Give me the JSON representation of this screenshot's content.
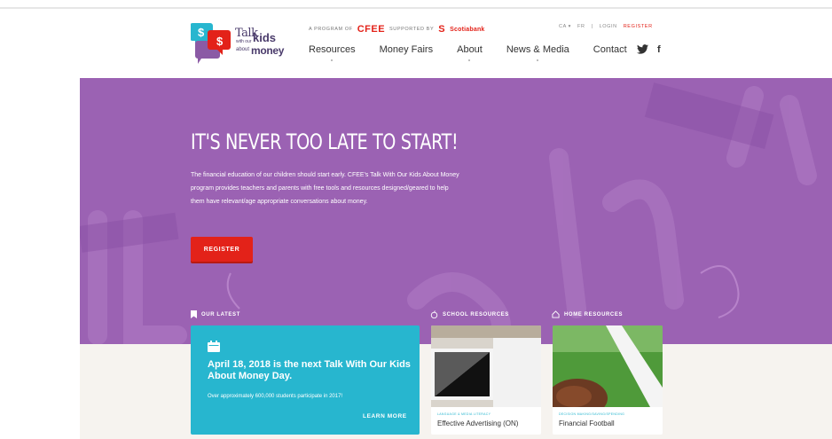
{
  "header": {
    "logo": {
      "talk": "Talk",
      "with_our": "with our",
      "kids": "kids",
      "about": "about",
      "money": "money"
    },
    "program_prefix": "A PROGRAM OF",
    "cfee": "CFEE",
    "supported_by": "SUPPORTED BY",
    "scotiabank": "Scotiabank",
    "util": {
      "region": "CA ▾",
      "fr": "FR",
      "sep": "|",
      "login": "LOGIN",
      "register": "REGISTER"
    },
    "nav": [
      "Resources",
      "Money Fairs",
      "About",
      "News & Media",
      "Contact"
    ],
    "social": {
      "twitter_glyph": "🐦",
      "facebook_glyph": "f"
    }
  },
  "hero": {
    "title": "IT'S NEVER TOO LATE TO START!",
    "body": "The financial education of our children should start early. CFEE's Talk With Our Kids About Money program provides teachers and parents with free tools and resources designed/geared to help them have relevant/age appropriate conversations about money.",
    "register_label": "REGISTER"
  },
  "sections": {
    "latest": "OUR LATEST",
    "school": "SCHOOL RESOURCES",
    "home": "HOME RESOURCES"
  },
  "latest_card": {
    "title": "April 18, 2018 is the next Talk With Our Kids About Money Day.",
    "subtitle": "Over approximately 600,000 students participate in 2017!",
    "link": "LEARN MORE"
  },
  "resources": [
    {
      "category": "LANGUAGE & MEDIA LITERACY",
      "title": "Effective Advertising (ON)"
    },
    {
      "category": "DECISION MAKING/SAVING/SPENDING",
      "title": "Financial Football"
    }
  ],
  "colors": {
    "hero_purple": "#9b62b3",
    "accent_red": "#e32219",
    "card_teal": "#27b6cf"
  }
}
